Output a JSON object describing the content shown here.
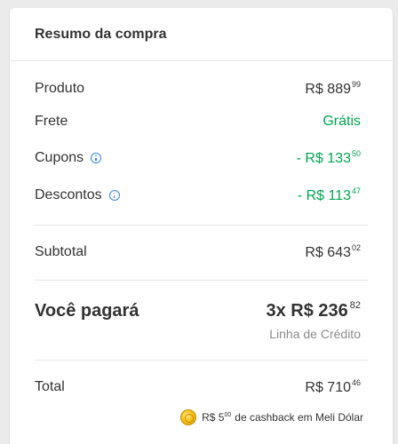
{
  "summary": {
    "title": "Resumo da compra",
    "rows": [
      {
        "label": "Produto",
        "amount": "R$ 889",
        "cents": "99"
      },
      {
        "label": "Frete",
        "amount": "Grátis"
      },
      {
        "label": "Cupons",
        "amount": "- R$ 133",
        "cents": "50"
      },
      {
        "label": "Descontos",
        "amount": "- R$ 113",
        "cents": "47"
      }
    ],
    "subtotal": {
      "label": "Subtotal",
      "amount": "R$ 643",
      "cents": "02"
    },
    "pay": {
      "label": "Você pagará",
      "amount": "3x R$ 236",
      "cents": "82",
      "note": "Linha de Crédito"
    },
    "total": {
      "label": "Total",
      "amount": "R$ 710",
      "cents": "46"
    },
    "cashback": {
      "amount": "R$ 5",
      "cents": "00",
      "text": "de cashback em Meli Dólar"
    }
  },
  "colors": {
    "discount_green": "#00a650",
    "info_blue": "#3483fa",
    "muted_gray": "#8c8c8c"
  },
  "icons": {
    "info": "info-circle-icon",
    "coin": "meli-dolar-coin-icon"
  }
}
